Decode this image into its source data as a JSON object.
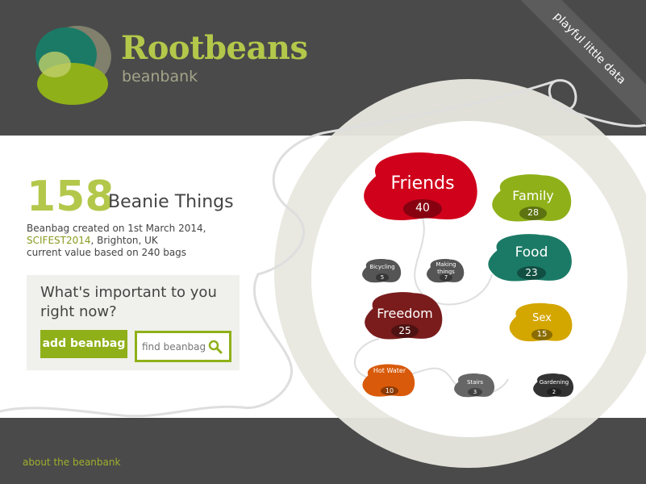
{
  "header": {
    "title": "Rootbeans",
    "subtitle": "beanbank",
    "ribbon": "playful little data"
  },
  "summary": {
    "count": "158",
    "count_label": "Beanie Things",
    "created_line": "Beanbag created on 1st March 2014,",
    "event_link": "SCIFEST2014",
    "event_location": ", Brighton, UK",
    "basis_line": "current value based on 240 bags"
  },
  "panel": {
    "question_line1": "What's important to you",
    "question_line2": "right now?",
    "add_label": "add beanbag",
    "search_placeholder": "find beanbag"
  },
  "footer": {
    "about": "about the beanbank"
  },
  "beans": [
    {
      "label": "Friends",
      "count": "40",
      "color": "#d0021b"
    },
    {
      "label": "Family",
      "count": "28",
      "color": "#8fb019"
    },
    {
      "label": "Food",
      "count": "23",
      "color": "#1b7a66"
    },
    {
      "label": "Bicycling",
      "count": "5",
      "color": "#555555"
    },
    {
      "label": "Making things",
      "count": "7",
      "color": "#555555"
    },
    {
      "label": "Freedom",
      "count": "25",
      "color": "#7a1c1c"
    },
    {
      "label": "Sex",
      "count": "15",
      "color": "#d4a600"
    },
    {
      "label": "Hot Water",
      "count": "10",
      "color": "#d85a0a"
    },
    {
      "label": "Stairs",
      "count": "3",
      "color": "#666666"
    },
    {
      "label": "Gardening",
      "count": "2",
      "color": "#333333"
    }
  ],
  "icons": {
    "logo": "rootbeans-logo",
    "search": "magnifier-icon"
  },
  "colors": {
    "accent": "#8fb019",
    "brand_text": "#b3c84a",
    "dark_band": "#4a4a4a"
  }
}
